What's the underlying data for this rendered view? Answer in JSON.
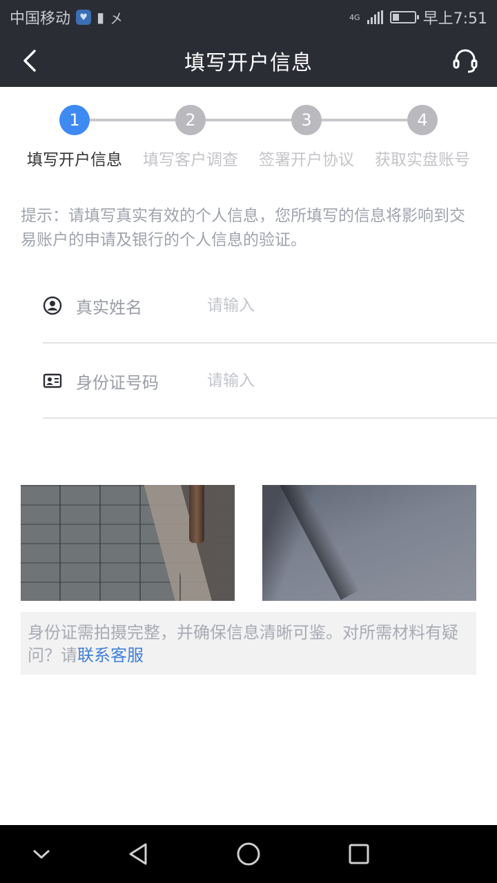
{
  "status_bar": {
    "carrier": "中国移动",
    "net_type": "4G",
    "time": "早上7:51",
    "battery_level": 0.3
  },
  "header": {
    "title": "填写开户信息",
    "back_icon": "chevron-left-icon",
    "support_icon": "headset-icon"
  },
  "steps": [
    {
      "number": "1",
      "label": "填写开户信息",
      "active": true
    },
    {
      "number": "2",
      "label": "填写客户调查",
      "active": false
    },
    {
      "number": "3",
      "label": "签署开户协议",
      "active": false
    },
    {
      "number": "4",
      "label": "获取实盘账号",
      "active": false
    }
  ],
  "hint": "提示：请填写真实有效的个人信息，您所填写的信息将影响到交易账户的申请及银行的个人信息的验证。",
  "form": {
    "name": {
      "label": "真实姓名",
      "placeholder": "请输入",
      "value": "",
      "icon": "user-circle-icon"
    },
    "id_number": {
      "label": "身份证号码",
      "placeholder": "请输入",
      "value": "",
      "icon": "id-card-icon"
    }
  },
  "notice": {
    "text": "身份证需拍摄完整，并确保信息清晰可鉴。对所需材料有疑问？请",
    "link": "联系客服"
  },
  "colors": {
    "header_bg": "#2b2d35",
    "accent": "#3e8af2",
    "link": "#3e7fd8"
  }
}
